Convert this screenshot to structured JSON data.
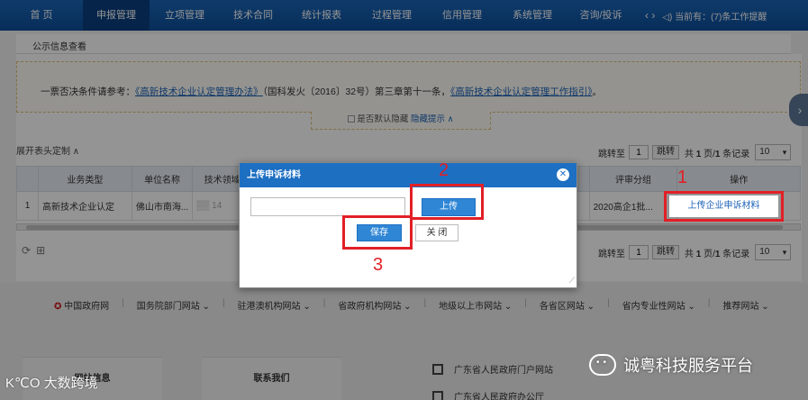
{
  "nav": {
    "items": [
      "首 页",
      "申报管理",
      "立项管理",
      "技术合同",
      "统计报表",
      "过程管理",
      "信用管理",
      "系统管理",
      "咨询/投诉"
    ],
    "active_index": 1,
    "arrows": "‹  ›",
    "notice": "◁) 当前有：(7)条工作提醒"
  },
  "breadcrumb": "公示信息查看",
  "notice_box": {
    "prefix": "一票否决条件请参考：",
    "link1": "《高新技术企业认定管理办法》",
    "middle": "（国科发火〔2016〕32号）第三章第十一条，",
    "link2": "《高新技术企业认定管理工作指引》",
    "suffix": "。"
  },
  "hide_toggle": {
    "label": "是否默认隐藏",
    "link": "隐藏提示 ∧"
  },
  "custom_head": "展开表头定制 ∧",
  "pager": {
    "jump_label": "跳转至",
    "page_value": "1",
    "jump_button": "跳转",
    "total_prefix": "共",
    "total_pages": "1",
    "pages_unit": "页/",
    "total_records": "1",
    "records_unit": "条记录",
    "page_size": "10"
  },
  "table": {
    "headers": [
      "",
      "业务类型",
      "单位名称",
      "技术领域",
      "",
      "评审分组",
      "操作"
    ],
    "rows": [
      [
        "1",
        "高新技术企业认定",
        "佛山市南海...",
        "▒▒ 14",
        "",
        "2020高企1批...",
        "上传企业申诉材料"
      ]
    ]
  },
  "tools": {
    "refresh": "⟳",
    "export": "⊞"
  },
  "footer": {
    "links": [
      "中国政府网",
      "国务院部门网站 ⌄",
      "驻港澳机构网站 ⌄",
      "省政府机构网站 ⌄",
      "地级以上市网站 ⌄",
      "各省区网站 ⌄",
      "省内专业性网站 ⌄",
      "推荐网站 ⌄"
    ],
    "block1": "网站信息",
    "block2": "联系我们",
    "qr1": "广东省人民政府门户网站",
    "qr2": "广东省人民政府办公厅"
  },
  "modal": {
    "title": "上传申诉材料",
    "close_glyph": "✕",
    "upload_label": "上传",
    "save_label": "保存",
    "close_label": "关 闭"
  },
  "annotations": {
    "n1": "1",
    "n2": "2",
    "n3": "3"
  },
  "watermarks": {
    "left": "K℃O 大数跨境",
    "right": "诚粤科技服务平台"
  },
  "colors": {
    "nav_blue": "#1a66b8",
    "modal_head": "#1d6fc2",
    "annotation_red": "#e21f26",
    "link_blue": "#1e63b8"
  }
}
